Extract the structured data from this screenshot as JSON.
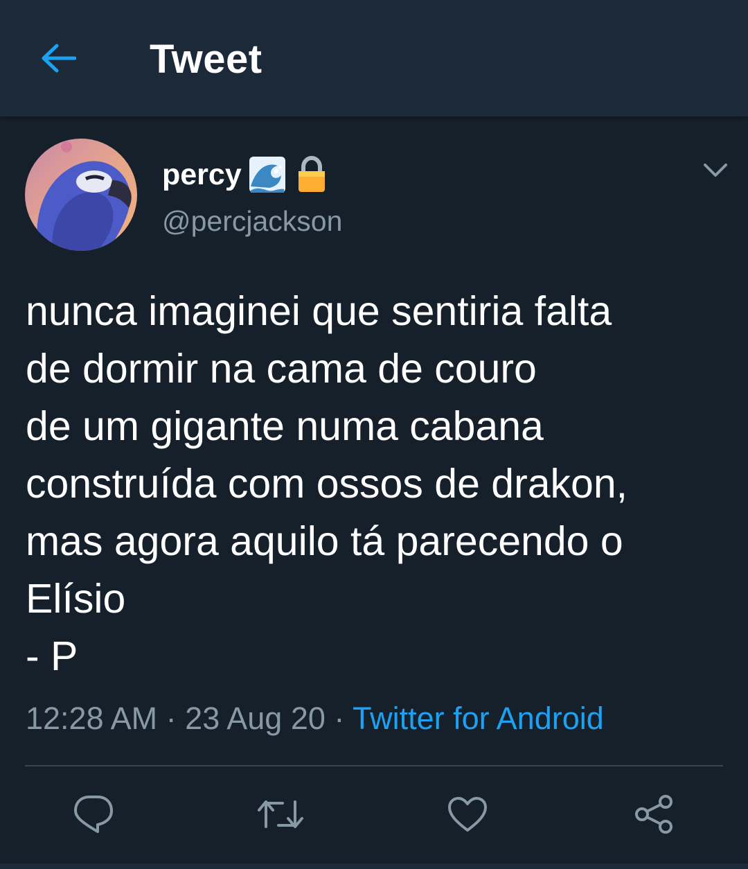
{
  "header": {
    "title": "Tweet",
    "back_icon": "arrow-left-icon",
    "accent_color": "#1da1f2"
  },
  "tweet": {
    "display_name": "percy",
    "badges": [
      "water-wave-emoji",
      "lock-emoji"
    ],
    "handle": "@percjackson",
    "text_lines": [
      "nunca imaginei que sentiria falta",
      "de dormir na cama de couro",
      "de um gigante numa cabana",
      "construída com ossos de drakon,",
      "mas agora aquilo tá parecendo o",
      "Elísio",
      "- P"
    ],
    "time": "12:28 AM",
    "separator": "·",
    "date": "23 Aug 20",
    "source": "Twitter for Android"
  },
  "actions": [
    "reply-icon",
    "retweet-icon",
    "like-icon",
    "share-icon"
  ],
  "colors": {
    "background": "#15202b",
    "header_background": "#1c2938",
    "secondary_text": "#8899a6",
    "link": "#1da1f2"
  }
}
